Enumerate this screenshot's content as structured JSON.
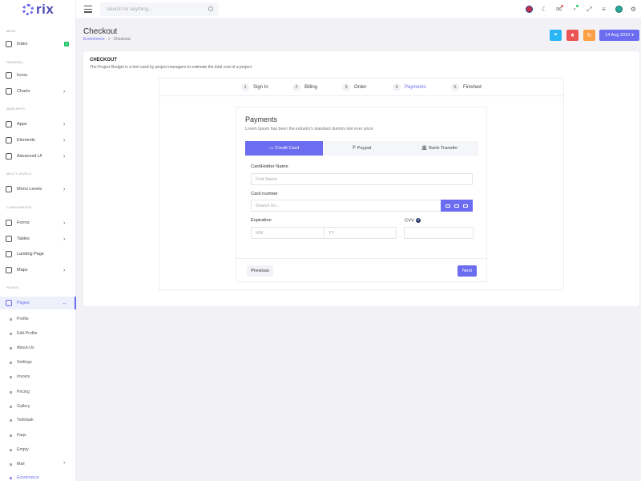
{
  "brand": {
    "logo_text": "rix"
  },
  "sidebar": {
    "categories": {
      "main": "MAIN",
      "general": "GENERAL",
      "web_apps": "WEB APPS",
      "multi_levels": "MULTI LEVELS",
      "components": "COMPONENTS",
      "pages": "PAGES"
    },
    "items": {
      "index": {
        "label": "Index",
        "badge": "1"
      },
      "icons": {
        "label": "Icons"
      },
      "charts": {
        "label": "Charts"
      },
      "apps": {
        "label": "Apps"
      },
      "elements": {
        "label": "Elements"
      },
      "advanced_ui": {
        "label": "Advanced UI"
      },
      "menu_levels": {
        "label": "Menu Levels"
      },
      "forms": {
        "label": "Forms"
      },
      "tables": {
        "label": "Tables"
      },
      "landing_page": {
        "label": "Landing Page"
      },
      "maps": {
        "label": "Maps"
      },
      "pages": {
        "label": "Pages"
      }
    },
    "subitems": [
      "Profile",
      "Edit-Profile",
      "About-Us",
      "Settings",
      "Invoice",
      "Pricing",
      "Gallery",
      "Todotask",
      "Faqs",
      "Empty",
      "Mail",
      "Ecommerce"
    ]
  },
  "header": {
    "search_placeholder": "Search for anything...",
    "icons": [
      "hamburger-icon",
      "flag-icon",
      "moon-icon",
      "mail-icon",
      "bell-icon",
      "fullscreen-icon",
      "menu-icon",
      "avatar",
      "gear-icon"
    ],
    "colors": {
      "accent": "#6c6cf0",
      "notify_pip": "#ea5455",
      "success_pip": "#28c76f"
    }
  },
  "page": {
    "title": "Checkout",
    "breadcrumb": {
      "parent": "Ecommerce",
      "separator": ">",
      "current": "Checkout"
    },
    "toolbar": {
      "filter_color": "#29b6f6",
      "star_color": "#ea5455",
      "refresh_color": "#ff9f43",
      "date_label": "14 Aug 2019"
    }
  },
  "card": {
    "title": "CHECKOUT",
    "description": "The Project Budget is a tool used by project managers to estimate the total cost of a project",
    "steps": [
      {
        "num": "1",
        "label": "Sign In"
      },
      {
        "num": "2",
        "label": "Billing"
      },
      {
        "num": "3",
        "label": "Order"
      },
      {
        "num": "4",
        "label": "Payments"
      },
      {
        "num": "5",
        "label": "Finished"
      }
    ],
    "current_step": 4,
    "payments": {
      "title": "Payments",
      "subtitle": "Lorem Ipsum has been the industry's standard dummy text ever since",
      "tabs": {
        "credit_card": "Credit Card",
        "paypal": "Paypal",
        "bank_transfer": "Bank Transfer"
      },
      "cardholder_label": "CardHolder Name",
      "cardholder_placeholder": "First Name",
      "cardnumber_label": "Card number",
      "cardnumber_placeholder": "Search for...",
      "expiration_label": "Expiration",
      "month_placeholder": "MM",
      "year_placeholder": "YY",
      "cvv_label": "CVV",
      "cvv_help": "?",
      "prev_label": "Previous",
      "next_label": "Next"
    }
  }
}
